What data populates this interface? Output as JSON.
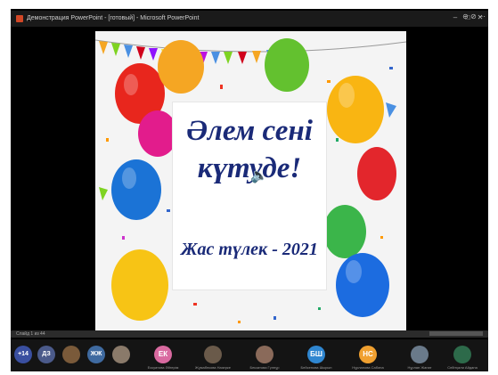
{
  "window": {
    "title": "Демонстрация PowerPoint - [готовый] - Microsoft PowerPoint",
    "accent": "#d24726"
  },
  "slide": {
    "line1": "Әлем сені",
    "line2": "күтуде!",
    "subtitle": "Жас түлек - 2021",
    "text_color": "#1a2a78",
    "speaker_icon": "speaker-icon"
  },
  "status": {
    "left": "Слайд 1 из 44"
  },
  "participants": {
    "overflow": "+14",
    "chips": [
      {
        "initials": "ДЗ",
        "color": "#4b5a8a"
      },
      {
        "initials": "",
        "color": "#7a5a3a"
      },
      {
        "initials": "ЖЖ",
        "color": "#3f6aa0"
      },
      {
        "initials": "",
        "color": "#8a7a6a"
      }
    ],
    "tiles": [
      {
        "initials": "ЕК",
        "color": "#d96aa0",
        "name": "Ескуатова Әйгерім"
      },
      {
        "initials": "",
        "color": "#6a5a4a",
        "name": "Жұмабекова Назерке"
      },
      {
        "initials": "",
        "color": "#8a6a5a",
        "name": "Бекзатова Гүлнұр"
      },
      {
        "initials": "БШ",
        "color": "#2f86d0",
        "name": "Бейсенова Шырын"
      },
      {
        "initials": "НС",
        "color": "#f0a030",
        "name": "Нұрланова Сабина"
      },
      {
        "initials": "",
        "color": "#6a7a8a",
        "name": "Нұрлан Жанат"
      },
      {
        "initials": "",
        "color": "#2d6a4a",
        "name": "Сейітқали Айдана"
      }
    ]
  }
}
